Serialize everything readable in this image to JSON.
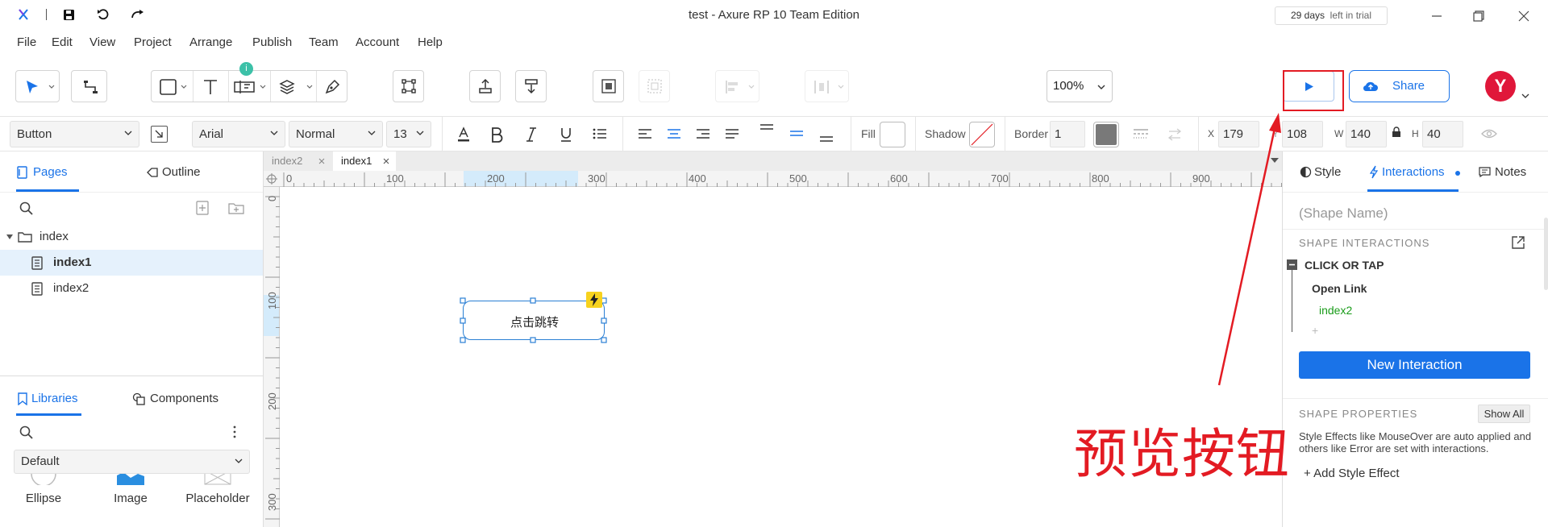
{
  "window": {
    "title": "test - Axure RP 10 Team Edition",
    "trial_days": "29 days",
    "trial_suffix": "left in trial"
  },
  "menu": [
    "File",
    "Edit",
    "View",
    "Project",
    "Arrange",
    "Publish",
    "Team",
    "Account",
    "Help"
  ],
  "toolbar": {
    "badge": "i",
    "zoom": "100%",
    "share_label": "Share",
    "avatar_letter": "Y"
  },
  "format": {
    "style": "Button",
    "font_family": "Arial",
    "font_weight": "Normal",
    "font_size": "13",
    "fill_label": "Fill",
    "shadow_label": "Shadow",
    "border_label": "Border",
    "border_value": "1",
    "x_label": "X",
    "x": "179",
    "y_label": "Y",
    "y": "108",
    "w_label": "W",
    "w": "140",
    "h_label": "H",
    "h": "40"
  },
  "left": {
    "tab_pages": "Pages",
    "tab_outline": "Outline",
    "folder": "index",
    "pages": [
      "index1",
      "index2"
    ],
    "tab_libraries": "Libraries",
    "tab_components": "Components",
    "library_select": "Default",
    "widgets": [
      "Ellipse",
      "Image",
      "Placeholder"
    ]
  },
  "canvas": {
    "tabs": [
      "index2",
      "index1"
    ],
    "ruler_h": [
      "0",
      "100",
      "200",
      "300",
      "400",
      "500",
      "600",
      "700",
      "800",
      "900"
    ],
    "ruler_v": [
      "0",
      "100",
      "200",
      "300"
    ],
    "button_text": "点击跳转"
  },
  "right": {
    "tab_style": "Style",
    "tab_interactions": "Interactions",
    "tab_notes": "Notes",
    "shape_name_placeholder": "(Shape Name)",
    "section_interactions": "SHAPE INTERACTIONS",
    "event": "CLICK OR TAP",
    "action": "Open Link",
    "target": "index2",
    "add": "+",
    "new_interaction": "New Interaction",
    "section_properties": "SHAPE PROPERTIES",
    "show_all": "Show All",
    "props_text": "Style Effects like MouseOver are auto applied and others like Error are set with interactions.",
    "add_style_effect": "+ Add Style Effect"
  },
  "annotation": "预览按钮",
  "colors": {
    "accent": "#1a73e8",
    "annotation": "#e31b23",
    "avatar": "#e0173a",
    "link": "#1a9c1a"
  }
}
